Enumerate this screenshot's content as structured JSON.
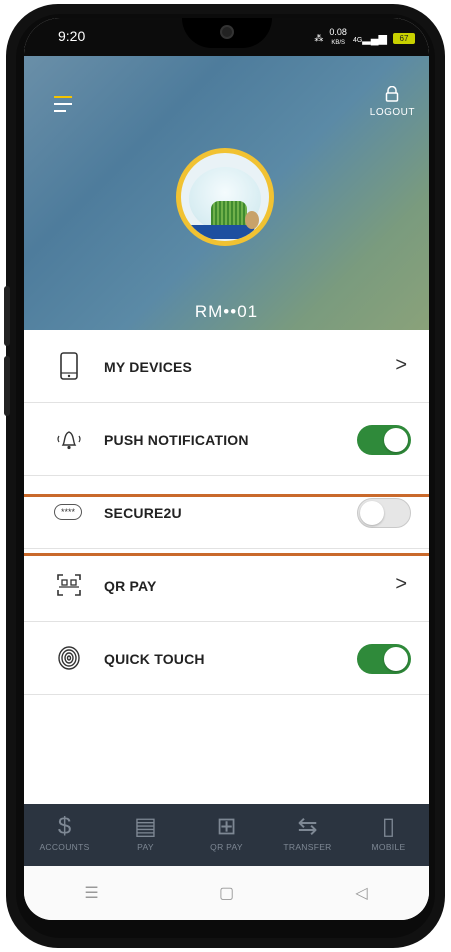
{
  "status_bar": {
    "time": "9:20",
    "network_speed_value": "0.08",
    "network_speed_unit": "KB/S",
    "signal_label": "4G",
    "battery_level": "67"
  },
  "header": {
    "logout_label": "LOGOUT",
    "account_masked": "RM••01"
  },
  "settings": {
    "items": [
      {
        "label": "MY DEVICES",
        "icon": "phone-icon",
        "control": "chevron"
      },
      {
        "label": "PUSH NOTIFICATION",
        "icon": "bell-icon",
        "control": "toggle",
        "on": true
      },
      {
        "label": "SECURE2U",
        "icon": "password-icon",
        "icon_text": "****",
        "control": "toggle",
        "on": false
      },
      {
        "label": "QR PAY",
        "icon": "qr-code-icon",
        "control": "chevron"
      },
      {
        "label": "QUICK TOUCH",
        "icon": "fingerprint-icon",
        "control": "toggle",
        "on": true
      }
    ],
    "chevron_glyph": ">"
  },
  "bottom_nav": {
    "items": [
      {
        "label": "ACCOUNTS",
        "icon": "dollar-icon",
        "glyph": "$"
      },
      {
        "label": "PAY",
        "icon": "bill-icon",
        "glyph": "▤"
      },
      {
        "label": "QR PAY",
        "icon": "qr-icon",
        "glyph": "⊞"
      },
      {
        "label": "TRANSFER",
        "icon": "transfer-icon",
        "glyph": "⇆"
      },
      {
        "label": "MOBILE",
        "icon": "mobile-icon",
        "glyph": "▯"
      }
    ]
  },
  "system_nav": {
    "menu_glyph": "☰",
    "home_glyph": "▢",
    "back_glyph": "◁"
  },
  "colors": {
    "toggle_on": "#2f8a3a",
    "highlight": "#c9692b",
    "bottom_nav_bg": "#2b3440",
    "avatar_ring": "#f1c232"
  }
}
